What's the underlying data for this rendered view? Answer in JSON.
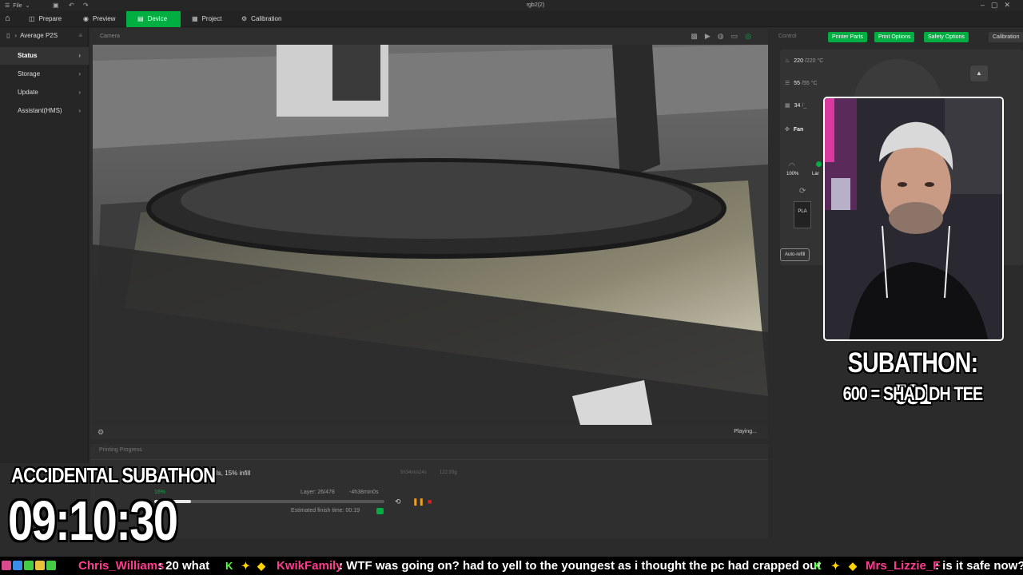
{
  "titlebar": {
    "file_label": "File",
    "window_title": "rgb2(2)",
    "icons": [
      "menu-icon",
      "save-icon",
      "undo-icon",
      "redo-icon"
    ],
    "controls": [
      "minimize-icon",
      "maximize-icon",
      "close-icon"
    ]
  },
  "nav": {
    "tabs": [
      {
        "label": "Prepare",
        "icon": "cube-icon"
      },
      {
        "label": "Preview",
        "icon": "eye-icon"
      },
      {
        "label": "Device",
        "icon": "device-icon",
        "active": true
      },
      {
        "label": "Project",
        "icon": "project-icon"
      },
      {
        "label": "Calibration",
        "icon": "calibration-icon"
      }
    ]
  },
  "sidebar": {
    "printer_name": "Average P2S",
    "items": [
      {
        "label": "Status",
        "active": true
      },
      {
        "label": "Storage"
      },
      {
        "label": "Update"
      },
      {
        "label": "Assistant(HMS)"
      }
    ]
  },
  "camera": {
    "label": "Camera",
    "status": "Playing..."
  },
  "progress": {
    "label": "Printing Progress",
    "job_name": "walls, 15% infill",
    "meta_time": "5h34min24s",
    "meta_weight": "122.93g",
    "percent_text": "16%",
    "percent": 0.16,
    "layer": "Layer: 26/478",
    "remaining": "-4h38min0s",
    "estimated_finish": "Estimated finish time: 00:19"
  },
  "control": {
    "label": "Control",
    "buttons": [
      "Printer Parts",
      "Print Options",
      "Safety Options",
      "Calibration"
    ],
    "nozzle_temp": "220",
    "nozzle_target": "/220",
    "nozzle_unit": "°C",
    "bed_temp": "55",
    "bed_target": "/55",
    "bed_unit": "°C",
    "chamber_temp": "34",
    "chamber_target": "/_",
    "fan_label": "Fan",
    "fan_pct": "100%",
    "fan_sub": "Lar",
    "filament": "PLA",
    "auto_refill": "Auto-refill"
  },
  "overlay": {
    "subathon": "SUBATHON: 581",
    "goal": "600 = SHAD DH TEE",
    "accidental": "ACCIDENTAL SUBATHON",
    "timer": "09:10:30"
  },
  "ticker": {
    "entries": [
      {
        "user": "Chris_Williams",
        "msg": ": 20 what"
      },
      {
        "user": "KwikFamily",
        "msg": ": WTF was going on? had to yell to the youngest as i thought the pc had crapped out"
      },
      {
        "user": "Mrs_Lizzie_F",
        "msg": ": is it safe now?"
      }
    ]
  },
  "colors": {
    "accent": "#00ae42",
    "ticker_user": "#ff3b8e"
  }
}
